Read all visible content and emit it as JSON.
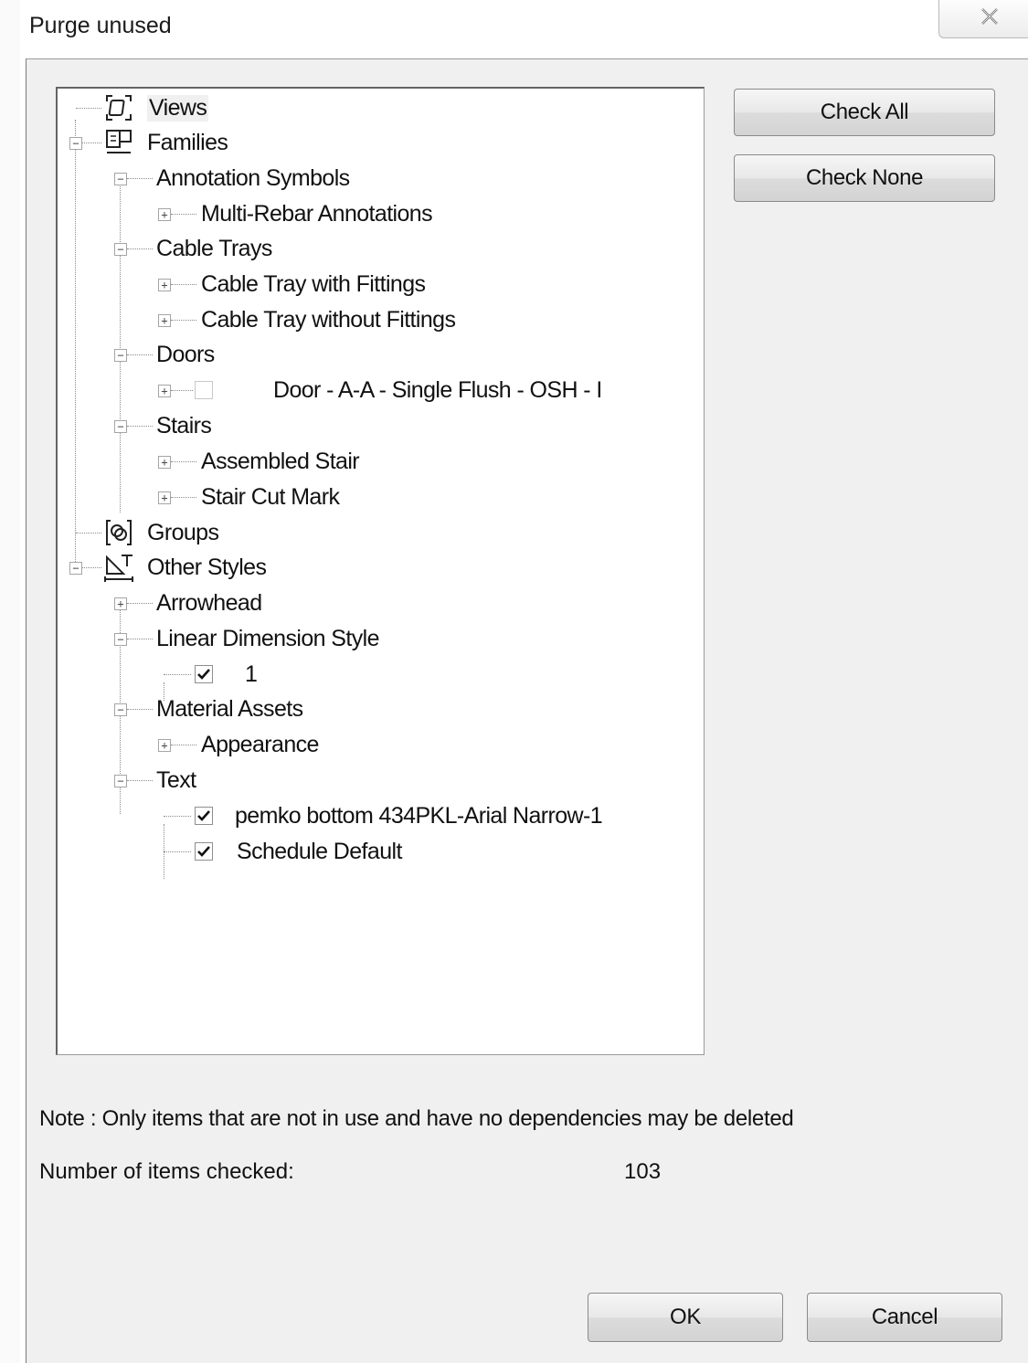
{
  "window": {
    "title": "Purge unused",
    "close_icon": "close-icon"
  },
  "buttons": {
    "check_all": "Check All",
    "check_none": "Check None",
    "ok": "OK",
    "cancel": "Cancel"
  },
  "tree": {
    "views": "Views",
    "families": "Families",
    "annotation_symbols": "Annotation Symbols",
    "multi_rebar_annotations": "Multi-Rebar Annotations",
    "cable_trays": "Cable Trays",
    "cable_tray_with_fittings": "Cable Tray with Fittings",
    "cable_tray_without_fittings": "Cable Tray without Fittings",
    "doors": "Doors",
    "door_item": "Door - A-A - Single Flush - OSH - I",
    "stairs": "Stairs",
    "assembled_stair": "Assembled Stair",
    "stair_cut_mark": "Stair Cut Mark",
    "groups": "Groups",
    "other_styles": "Other Styles",
    "arrowhead": "Arrowhead",
    "linear_dimension_style": "Linear Dimension Style",
    "linear_dimension_item": "1",
    "material_assets": "Material Assets",
    "appearance": "Appearance",
    "text": "Text",
    "text_item_1": "pemko bottom 434PKL-Arial Narrow-1",
    "text_item_2": "Schedule Default"
  },
  "footer": {
    "note": "Note : Only items that are not in use and have no dependencies may be deleted",
    "count_label": "Number of items checked:",
    "count_value": "103"
  }
}
